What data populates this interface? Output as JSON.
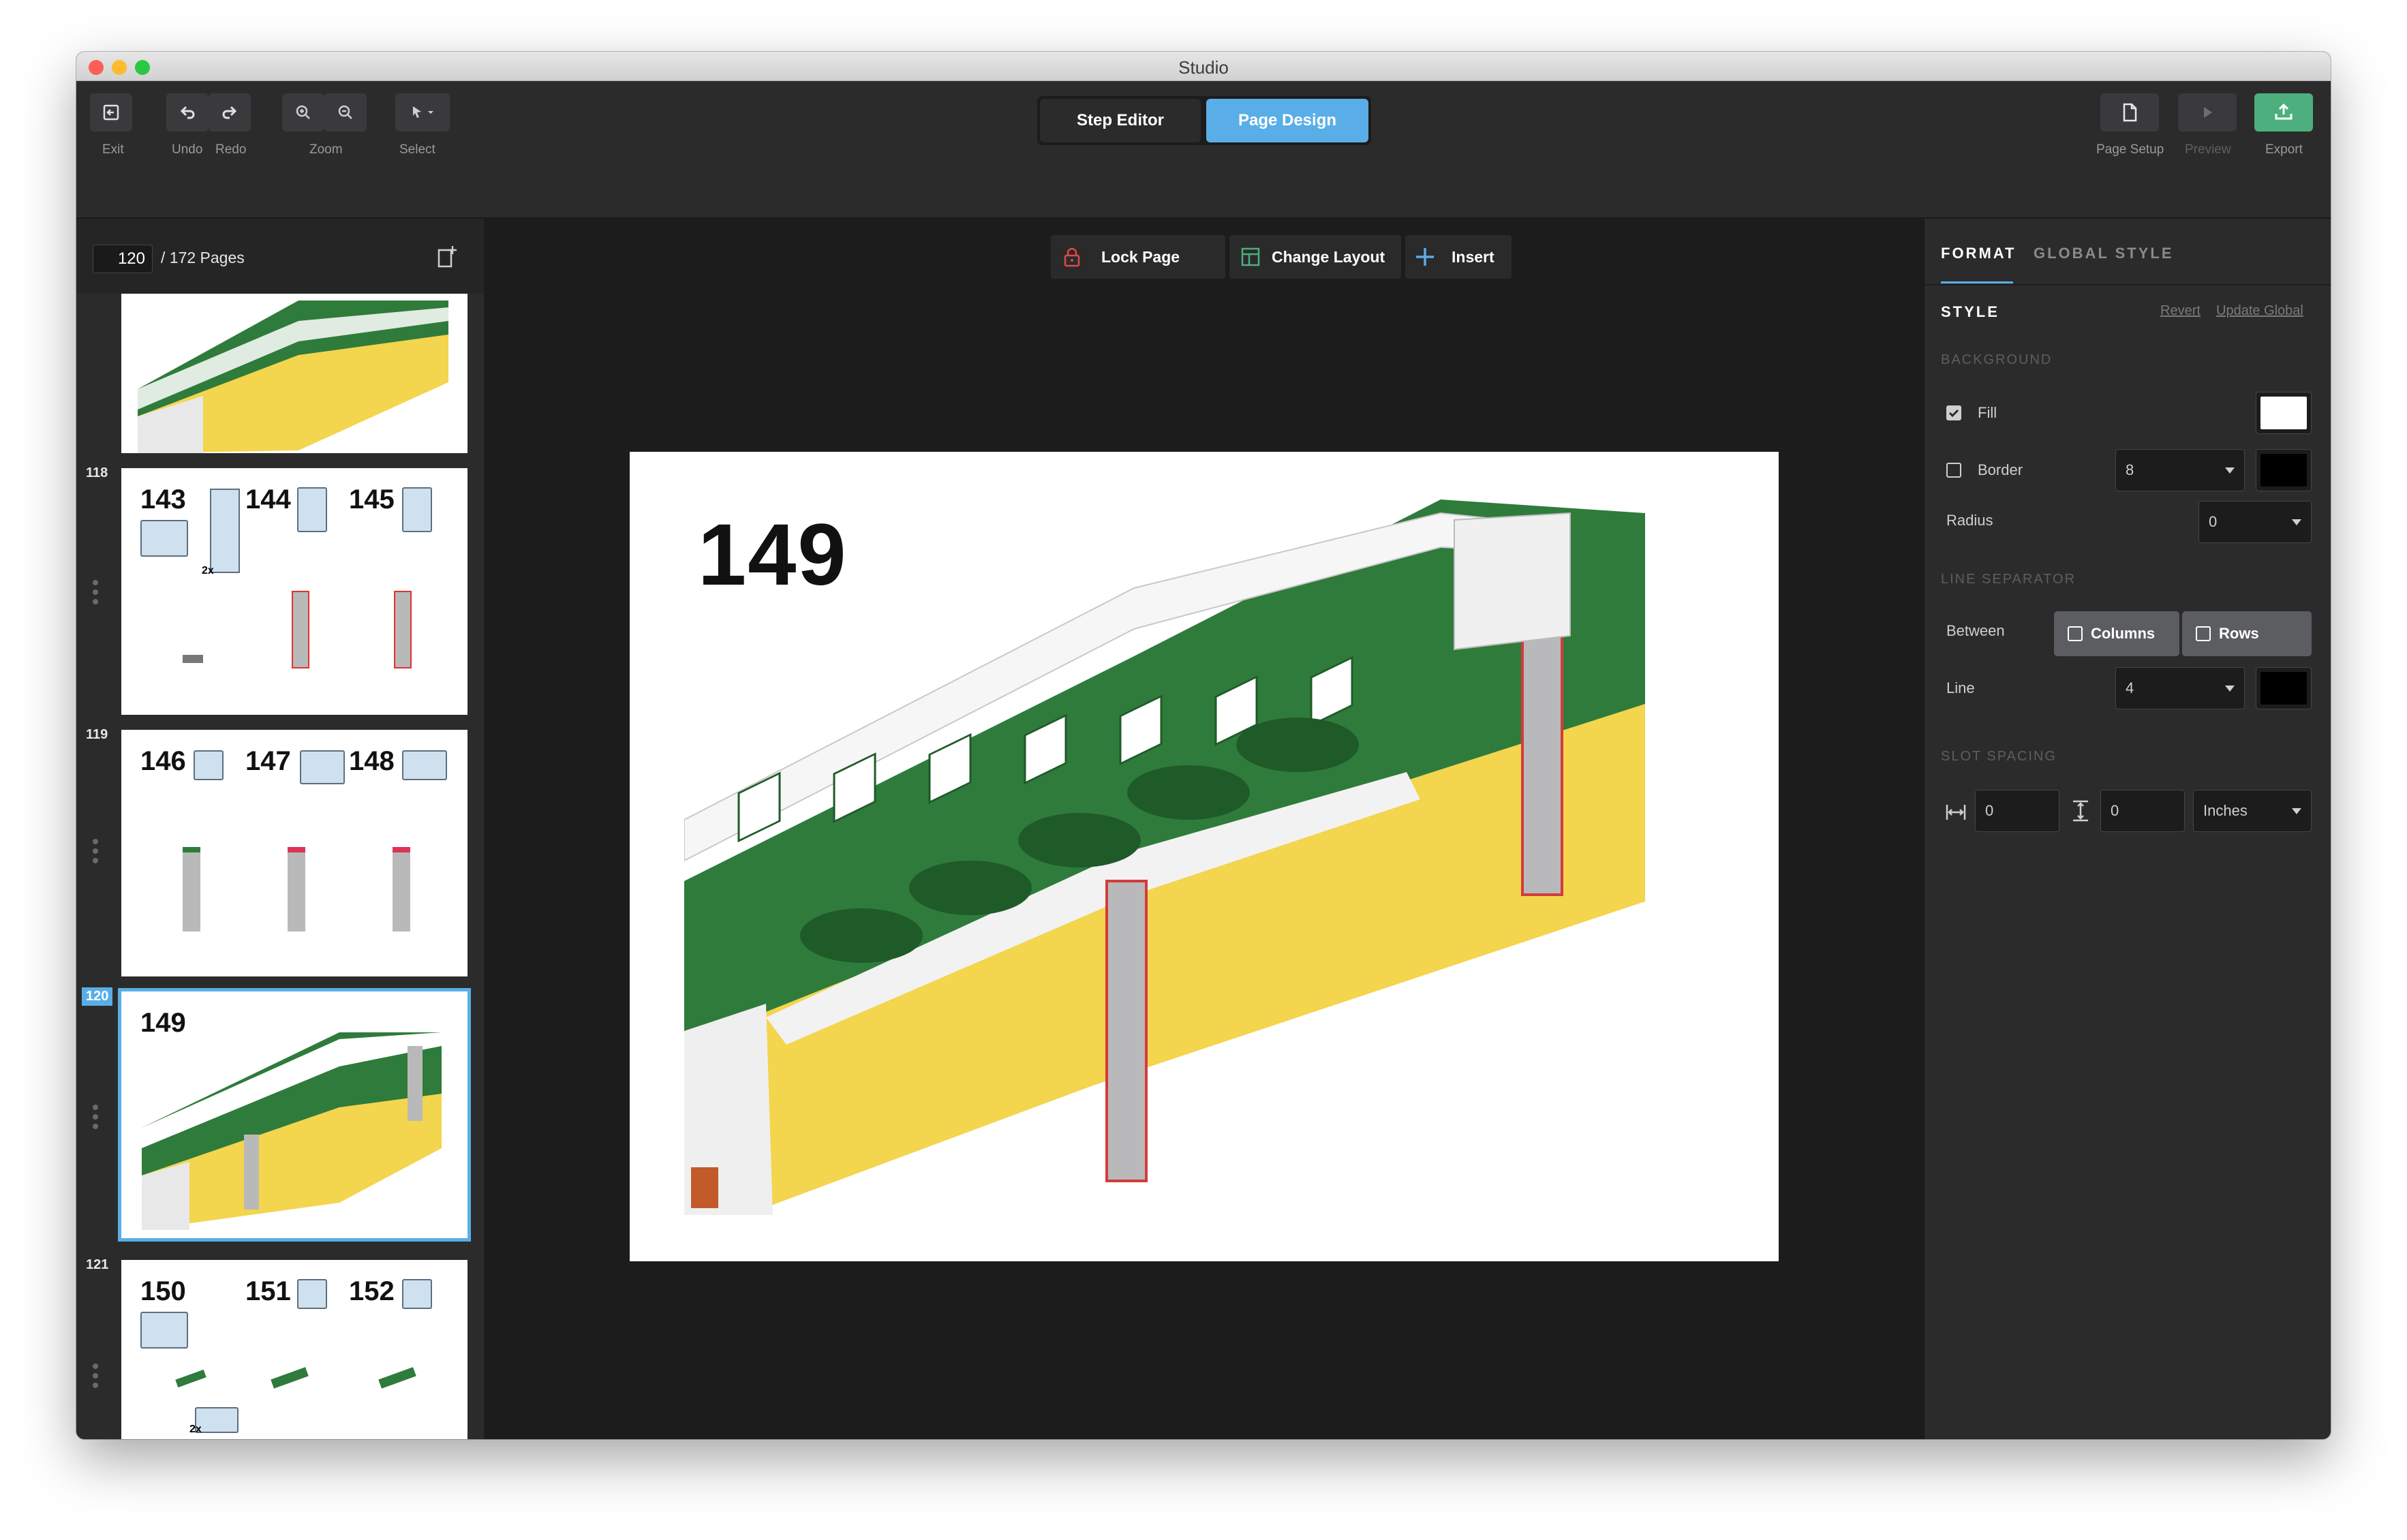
{
  "window": {
    "title": "Studio"
  },
  "toolbar": {
    "exit": "Exit",
    "undo": "Undo",
    "redo": "Redo",
    "zoom": "Zoom",
    "select": "Select",
    "page_setup": "Page Setup",
    "preview": "Preview",
    "export": "Export",
    "modes": [
      "Step Editor",
      "Page Design"
    ],
    "active_mode": "Page Design"
  },
  "pages": {
    "current": "120",
    "total_label": "/ 172 Pages"
  },
  "thumbnails": [
    {
      "num": "118",
      "steps": [
        "143",
        "144",
        "145"
      ],
      "qty": "2x"
    },
    {
      "num": "119",
      "steps": [
        "146",
        "147",
        "148"
      ]
    },
    {
      "num": "120",
      "steps": [
        "149"
      ]
    },
    {
      "num": "121",
      "steps": [
        "150",
        "151",
        "152"
      ],
      "qty": "2x"
    }
  ],
  "canvas": {
    "lock_page": "Lock Page",
    "change_layout": "Change Layout",
    "insert": "Insert",
    "step_number": "149"
  },
  "format": {
    "tabs": [
      "FORMAT",
      "GLOBAL STYLE"
    ],
    "style_heading": "STYLE",
    "revert": "Revert",
    "update_global": "Update Global",
    "background": {
      "heading": "BACKGROUND",
      "fill_label": "Fill",
      "fill_checked": true,
      "fill_color": "#ffffff",
      "border_label": "Border",
      "border_checked": false,
      "border_value": "8",
      "border_color": "#000000",
      "radius_label": "Radius",
      "radius_value": "0"
    },
    "line_separator": {
      "heading": "LINE SEPARATOR",
      "between_label": "Between",
      "columns": "Columns",
      "rows": "Rows",
      "line_label": "Line",
      "line_value": "4",
      "line_color": "#000000"
    },
    "slot_spacing": {
      "heading": "SLOT SPACING",
      "h_value": "0",
      "v_value": "0",
      "unit": "Inches"
    }
  },
  "colors": {
    "accent": "#5aaee8",
    "export_green": "#4caf7d",
    "lego_green": "#2f7b3b",
    "lego_yellow": "#f3d54e"
  }
}
